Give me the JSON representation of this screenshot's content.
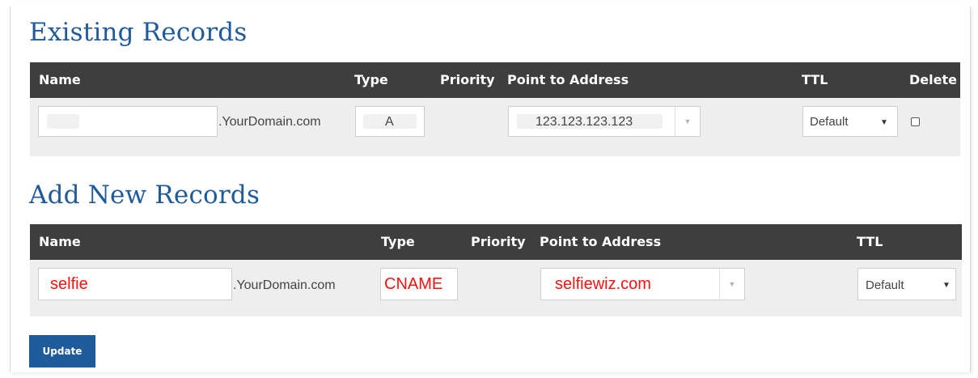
{
  "existing": {
    "title": "Existing Records",
    "headers": {
      "name": "Name",
      "type": "Type",
      "priority": "Priority",
      "address": "Point to Address",
      "ttl": "TTL",
      "delete": "Delete"
    },
    "record": {
      "name": "",
      "domain_suffix": ".YourDomain.com",
      "type": "A",
      "address": "123.123.123.123",
      "ttl": "Default",
      "delete_checked": false
    }
  },
  "add_new": {
    "title": "Add New Records",
    "headers": {
      "name": "Name",
      "type": "Type",
      "priority": "Priority",
      "address": "Point to Address",
      "ttl": "TTL"
    },
    "record": {
      "name": "selfie",
      "domain_suffix": ".YourDomain.com",
      "type": "CNAME",
      "address": "selfiewiz.com",
      "ttl": "Default"
    }
  },
  "update_button": "Update",
  "colors": {
    "accent": "#1f5a9c",
    "header_bg": "#3e3e3e",
    "row_bg": "#eeeeee",
    "highlight_text": "#ff1010"
  },
  "icons": {
    "dropdown": "chevron-down-icon",
    "checkbox": "checkbox-icon"
  }
}
